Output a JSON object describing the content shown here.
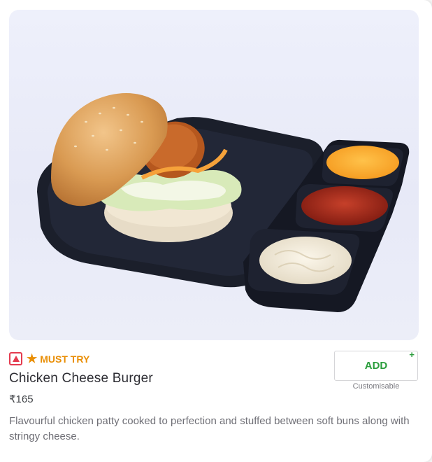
{
  "item": {
    "image_alt": "Chicken Cheese Burger",
    "veg_indicator_icon": "non-veg-triangle-icon",
    "tag_icon": "star-icon",
    "tag_label": "MUST TRY",
    "title": "Chicken Cheese Burger",
    "price": "₹165",
    "description": "Flavourful chicken patty cooked to perfection and stuffed between soft buns along with stringy cheese."
  },
  "add_button": {
    "label": "ADD",
    "plus": "+",
    "customisable_label": "Customisable"
  },
  "colors": {
    "nonveg": "#e43b4f",
    "must_try": "#e98e05",
    "add_green": "#2a9d3c"
  }
}
